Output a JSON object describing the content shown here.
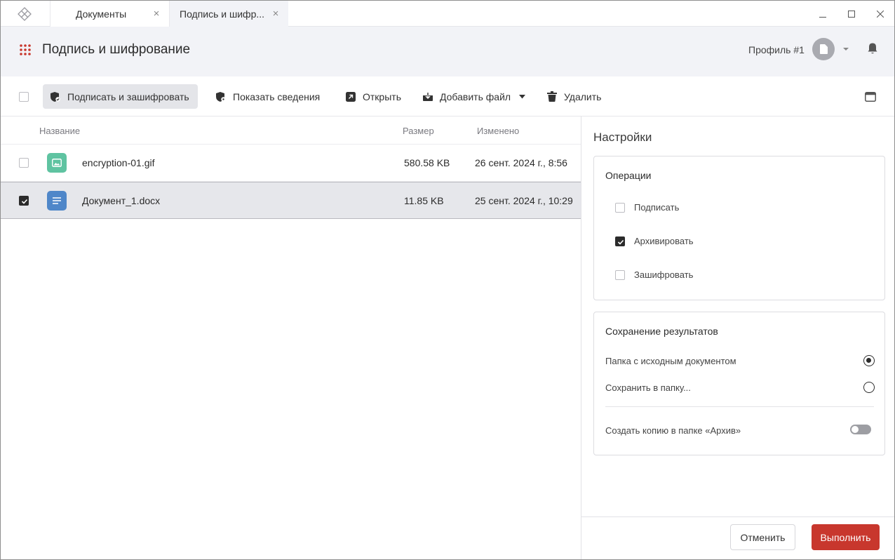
{
  "tabs": [
    {
      "label": "Документы",
      "active": false
    },
    {
      "label": "Подпись и шифр...",
      "active": true
    }
  ],
  "header": {
    "title": "Подпись и шифрование",
    "profile": "Профиль #1"
  },
  "toolbar": {
    "sign_encrypt": "Подписать и зашифровать",
    "show_info": "Показать сведения",
    "open": "Открыть",
    "add_file": "Добавить файл",
    "delete": "Удалить"
  },
  "table": {
    "columns": {
      "name": "Название",
      "size": "Размер",
      "modified": "Изменено"
    },
    "rows": [
      {
        "name": "encryption-01.gif",
        "size": "580.58 KB",
        "modified": "26 сент. 2024 г., 8:56",
        "type": "image",
        "checked": false,
        "selected": false
      },
      {
        "name": "Документ_1.docx",
        "size": "11.85 KB",
        "modified": "25 сент. 2024 г., 10:29",
        "type": "document",
        "checked": true,
        "selected": true
      }
    ]
  },
  "settings": {
    "title": "Настройки",
    "operations": {
      "title": "Операции",
      "items": [
        {
          "label": "Подписать",
          "checked": false
        },
        {
          "label": "Архивировать",
          "checked": true
        },
        {
          "label": "Зашифровать",
          "checked": false
        }
      ]
    },
    "save": {
      "title": "Сохранение результатов",
      "options": [
        {
          "label": "Папка с исходным документом",
          "selected": true
        },
        {
          "label": "Сохранить в папку...",
          "selected": false
        }
      ],
      "archive_copy": {
        "label": "Создать копию в папке «Архив»",
        "enabled": false
      }
    }
  },
  "footer": {
    "cancel": "Отменить",
    "run": "Выполнить"
  },
  "colors": {
    "accent": "#c8372d",
    "image_icon": "#5fc3a1",
    "doc_icon": "#4f87c9"
  }
}
